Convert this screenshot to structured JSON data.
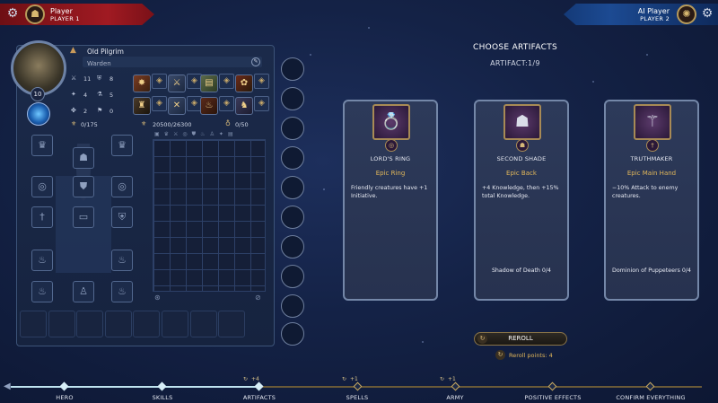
{
  "players": {
    "left": {
      "name": "Player",
      "label": "PLAYER 1",
      "color": "#a01a22"
    },
    "right": {
      "name": "AI Player",
      "label": "PLAYER 2",
      "color": "#1c4a92"
    }
  },
  "hero": {
    "name": "Old Pilgrim",
    "class": "Warden",
    "level": "10",
    "stats": [
      {
        "icon": "crossed-swords-icon",
        "value": "11"
      },
      {
        "icon": "shield-icon",
        "value": "8"
      },
      {
        "icon": "spell-power-icon",
        "value": "4"
      },
      {
        "icon": "knowledge-icon",
        "value": "5"
      },
      {
        "icon": "luck-icon",
        "value": "2"
      },
      {
        "icon": "morale-icon",
        "value": "0"
      }
    ],
    "experience": "0/175",
    "xp_total": "20500/26300",
    "mana": "0/50"
  },
  "artifacts_screen": {
    "title": "CHOOSE ARTIFACTS",
    "counter": "ARTIFACT:1/9",
    "cards": [
      {
        "name": "LORD'S RING",
        "type": "Epic Ring",
        "description": "Friendly creatures have +1 Initiative.",
        "set": ""
      },
      {
        "name": "SECOND SHADE",
        "type": "Epic Back",
        "description": "+4 Knowledge, then +15% total Knowledge.",
        "set": "Shadow of Death 0/4"
      },
      {
        "name": "TRUTHMAKER",
        "type": "Epic Main Hand",
        "description": "−10% Attack to enemy creatures.",
        "set": "Dominion of Puppeteers 0/4"
      }
    ],
    "reroll_label": "REROLL",
    "reroll_points": "Reroll points: 4"
  },
  "steps": [
    {
      "label": "HERO",
      "bonus": "",
      "done": true
    },
    {
      "label": "SKILLS",
      "bonus": "",
      "done": true
    },
    {
      "label": "ARTIFACTS",
      "bonus": "+4",
      "done": true
    },
    {
      "label": "SPELLS",
      "bonus": "+1",
      "done": false
    },
    {
      "label": "ARMY",
      "bonus": "+1",
      "done": false
    },
    {
      "label": "POSITIVE EFFECTS",
      "bonus": "",
      "done": false
    },
    {
      "label": "CONFIRM EVERYTHING",
      "bonus": "",
      "done": false
    }
  ],
  "colors": {
    "accent_gold": "#e2b75a",
    "track_done": "#bfe4f0"
  }
}
